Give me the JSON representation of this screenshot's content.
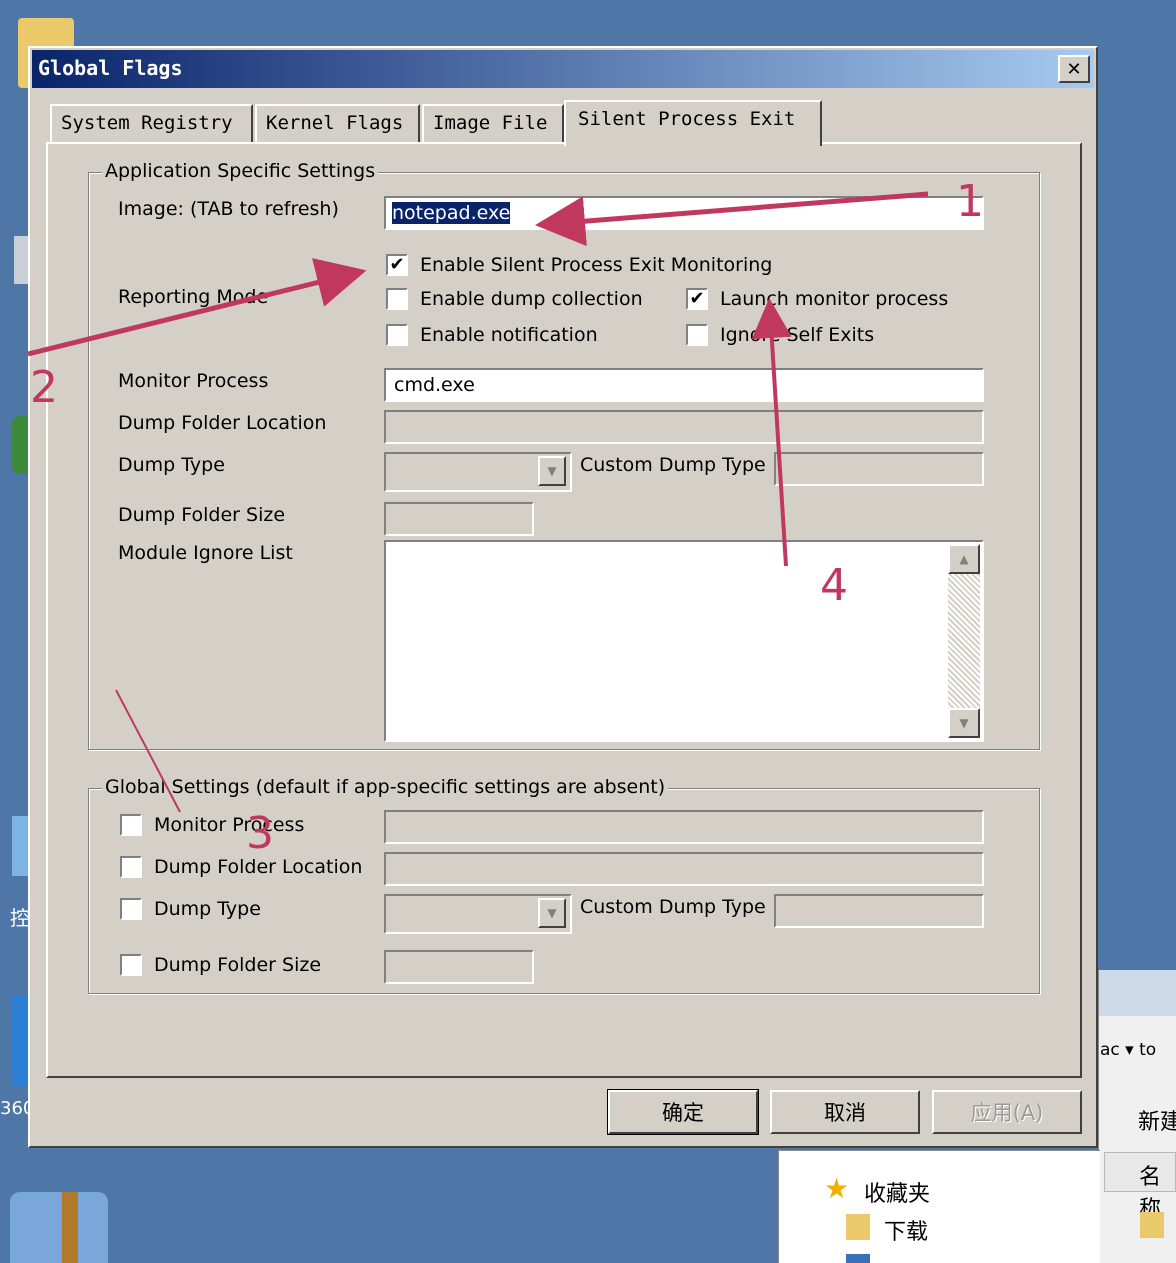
{
  "window": {
    "title": "Global Flags",
    "close_glyph": "✕"
  },
  "tabs": [
    {
      "label": "System Registry"
    },
    {
      "label": "Kernel Flags"
    },
    {
      "label": "Image File"
    },
    {
      "label": "Silent Process Exit",
      "active": true
    }
  ],
  "app_settings": {
    "legend": "Application Specific Settings",
    "image_label": "Image:  (TAB to refresh)",
    "image_value": "notepad.exe",
    "reporting_mode_label": "Reporting Mode",
    "checkboxes": {
      "enable_monitoring": {
        "label": "Enable Silent Process Exit Monitoring",
        "checked": true
      },
      "enable_dump": {
        "label": "Enable dump collection",
        "checked": false
      },
      "launch_monitor": {
        "label": "Launch monitor process",
        "checked": true
      },
      "enable_notification": {
        "label": "Enable notification",
        "checked": false
      },
      "ignore_self_exits": {
        "label": "Ignore Self Exits",
        "checked": false
      }
    },
    "monitor_process_label": "Monitor Process",
    "monitor_process_value": "cmd.exe",
    "dump_folder_location_label": "Dump Folder Location",
    "dump_type_label": "Dump Type",
    "custom_dump_type_label": "Custom Dump Type",
    "dump_folder_size_label": "Dump Folder Size",
    "module_ignore_list_label": "Module Ignore List"
  },
  "global_settings": {
    "legend": "Global Settings (default if app-specific settings are absent)",
    "monitor_process_label": "Monitor Process",
    "dump_folder_location_label": "Dump Folder Location",
    "dump_type_label": "Dump Type",
    "custom_dump_type_label": "Custom Dump Type",
    "dump_folder_size_label": "Dump Folder Size"
  },
  "buttons": {
    "ok": "确定",
    "cancel": "取消",
    "apply": "应用(A)"
  },
  "annotations": [
    "1",
    "2",
    "3",
    "4"
  ],
  "explorer": {
    "toolbar_text": "ac ▾ to",
    "new_label": "新建",
    "name_header": "名称",
    "favorites": "收藏夹",
    "downloads": "下载"
  },
  "desktop": {
    "icon_label": "360",
    "icon_label2": "控"
  },
  "colors": {
    "desktop": "#4e77a7",
    "dialog": "#d4d0c8",
    "annotation": "#c0385e",
    "title_start": "#0a246a",
    "title_end": "#a6caf0"
  }
}
